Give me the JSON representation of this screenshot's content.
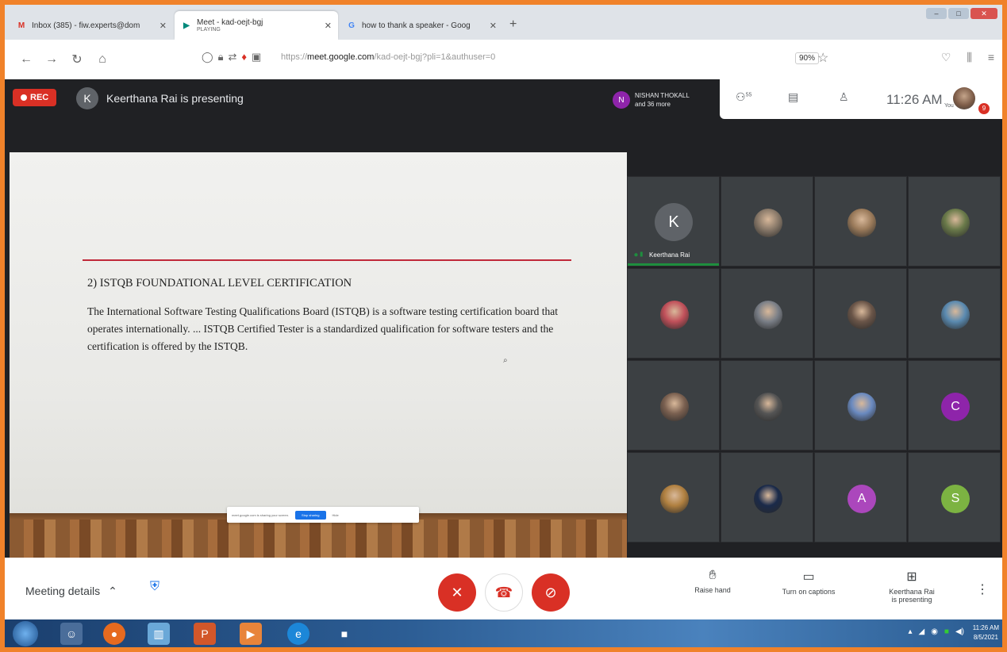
{
  "browser": {
    "tabs": [
      {
        "title": "Inbox (385) - fiw.experts@dom",
        "favicon": "M",
        "active": false
      },
      {
        "title": "Meet - kad-oejt-bgj",
        "subtitle": "PLAYING",
        "favicon": "meet",
        "active": true
      },
      {
        "title": "how to thank a speaker - Goog",
        "favicon": "G",
        "active": false
      }
    ],
    "url_prefix": "https://",
    "url_domain": "meet.google.com",
    "url_path": "/kad-oejt-bgj?pli=1&authuser=0",
    "zoom": "90%"
  },
  "meet_top": {
    "rec_label": "REC",
    "presenter_initial": "K",
    "presenting_text": "Keerthana Rai is presenting",
    "participants_line1": "NISHAN THOKALL",
    "participants_line2": "and 36 more",
    "participants_initial": "N",
    "people_count": "55",
    "time": "11:26 AM",
    "you_label": "You",
    "notification_count": "9"
  },
  "slide": {
    "title": "2) ISTQB FOUNDATIONAL LEVEL CERTIFICATION",
    "body": "The International Software Testing Qualifications Board (ISTQB) is a software testing certification board that operates internationally. ... ISTQB Certified Tester is a standardized qualification for software testers and the certification is offered by the ISTQB.",
    "share_notice": "meet.google.com is sharing your screen.",
    "share_stop": "Stop sharing",
    "share_hide": "Hide"
  },
  "grid": {
    "tiles": [
      {
        "type": "letter",
        "initial": "K",
        "name": "Keerthana Rai",
        "speaking": true
      },
      {
        "type": "photo",
        "color": "#8a7a6a"
      },
      {
        "type": "photo",
        "color": "#9a7a5a"
      },
      {
        "type": "photo",
        "color": "#6a7a4a"
      },
      {
        "type": "photo",
        "color": "#c0505a"
      },
      {
        "type": "photo",
        "color": "#7a7f87"
      },
      {
        "type": "photo",
        "color": "#6a5548"
      },
      {
        "type": "photo",
        "color": "#5a8ab0"
      },
      {
        "type": "photo",
        "color": "#7a6050"
      },
      {
        "type": "photo",
        "color": "#555555"
      },
      {
        "type": "photo",
        "color": "#6a8ac0"
      },
      {
        "type": "letter-color",
        "initial": "C",
        "color": "#8e24aa"
      },
      {
        "type": "photo",
        "color": "#b08040"
      },
      {
        "type": "photo",
        "color": "#1a2a4a"
      },
      {
        "type": "letter-color",
        "initial": "A",
        "color": "#ab47bc"
      },
      {
        "type": "letter-color",
        "initial": "S",
        "color": "#7cb342"
      }
    ]
  },
  "bottom": {
    "meeting_details": "Meeting details",
    "raise_hand": "Raise hand",
    "captions": "Turn on captions",
    "presenting_line1": "Keerthana Rai",
    "presenting_line2": "is presenting"
  },
  "taskbar": {
    "time": "11:26 AM",
    "date": "8/5/2021"
  },
  "colors": {
    "accent_red": "#d93025",
    "meet_green": "#1e8e3e",
    "frame_orange": "#f0822a"
  }
}
